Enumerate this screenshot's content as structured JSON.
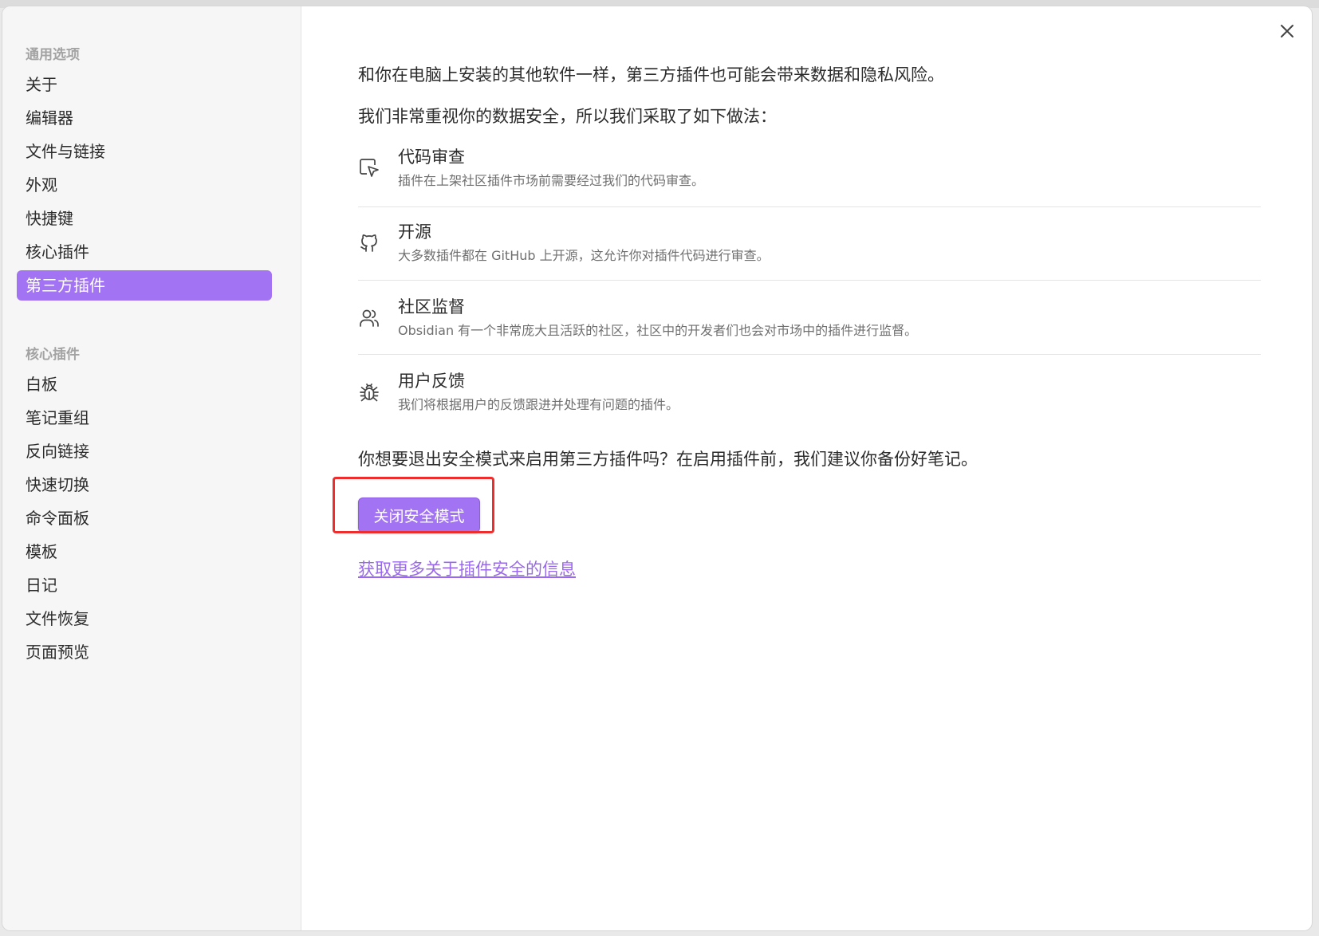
{
  "sidebar": {
    "general_heading": "通用选项",
    "general_items": [
      {
        "label": "关于"
      },
      {
        "label": "编辑器"
      },
      {
        "label": "文件与链接"
      },
      {
        "label": "外观"
      },
      {
        "label": "快捷键"
      },
      {
        "label": "核心插件"
      },
      {
        "label": "第三方插件",
        "active": true
      }
    ],
    "core_heading": "核心插件",
    "core_items": [
      {
        "label": "白板"
      },
      {
        "label": "笔记重组"
      },
      {
        "label": "反向链接"
      },
      {
        "label": "快速切换"
      },
      {
        "label": "命令面板"
      },
      {
        "label": "模板"
      },
      {
        "label": "日记"
      },
      {
        "label": "文件恢复"
      },
      {
        "label": "页面预览"
      }
    ]
  },
  "main": {
    "intro_1": "和你在电脑上安装的其他软件一样，第三方插件也可能会带来数据和隐私风险。",
    "intro_2": "我们非常重视你的数据安全，所以我们采取了如下做法：",
    "features": [
      {
        "icon": "pointer-icon",
        "title": "代码审查",
        "desc": "插件在上架社区插件市场前需要经过我们的代码审查。"
      },
      {
        "icon": "github-icon",
        "title": "开源",
        "desc": "大多数插件都在 GitHub 上开源，这允许你对插件代码进行审查。"
      },
      {
        "icon": "users-icon",
        "title": "社区监督",
        "desc": "Obsidian 有一个非常庞大且活跃的社区，社区中的开发者们也会对市场中的插件进行监督。"
      },
      {
        "icon": "bug-icon",
        "title": "用户反馈",
        "desc": "我们将根据用户的反馈跟进并处理有问题的插件。"
      }
    ],
    "question": "你想要退出安全模式来启用第三方插件吗？在启用插件前，我们建议你备份好笔记。",
    "button_label": "关闭安全模式",
    "link_label": "获取更多关于插件安全的信息"
  },
  "colors": {
    "accent": "#a273f2",
    "link": "#9a68ee",
    "highlight": "#ef2d2d"
  }
}
